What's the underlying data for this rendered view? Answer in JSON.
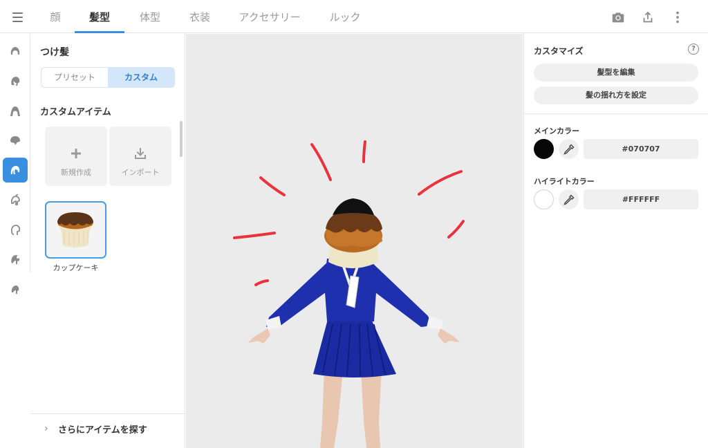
{
  "topbar": {
    "tabs": [
      {
        "label": "顔"
      },
      {
        "label": "髪型"
      },
      {
        "label": "体型"
      },
      {
        "label": "衣装"
      },
      {
        "label": "アクセサリー"
      },
      {
        "label": "ルック"
      }
    ],
    "active_tab": "髪型",
    "icons": [
      "menu-icon",
      "camera-icon",
      "share-icon",
      "more-vertical-icon"
    ]
  },
  "sidebar": {
    "categories": [
      "hair-front-icon",
      "hair-side-icon",
      "hair-long-icon",
      "hair-back-icon",
      "hair-extension-icon",
      "ahoge-icon",
      "sideburn-icon",
      "hair-accessory-icon",
      "hair-other-icon"
    ],
    "active_index": 4
  },
  "left_panel": {
    "title": "つけ髪",
    "segment": {
      "preset": "プリセット",
      "custom": "カスタム",
      "selected": "カスタム"
    },
    "section_title": "カスタムアイテム",
    "new_label": "新規作成",
    "import_label": "インポート",
    "selected_item": "カップケーキ",
    "more_label": "さらにアイテムを探す"
  },
  "right_panel": {
    "title": "カスタマイズ",
    "help": "?",
    "edit_hair_button": "髪型を編集",
    "sway_button": "髪の揺れ方を設定",
    "main_color_label": "メインカラー",
    "main_color_hex": "#070707",
    "highlight_color_label": "ハイライトカラー",
    "highlight_color_hex": "#FFFFFF"
  },
  "colors": {
    "accent": "#3b8fe0",
    "uniform_navy": "#1a2aa0",
    "emotion_lines": "#e8323c",
    "cupcake_top": "#5a3418",
    "cupcake_base": "#efe6c8"
  }
}
